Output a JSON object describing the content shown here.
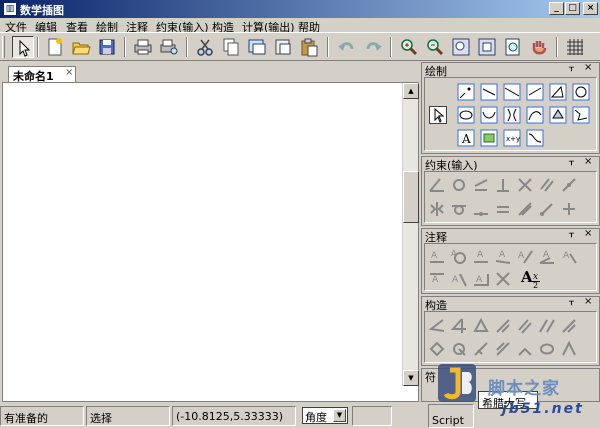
{
  "window": {
    "title": "数学插图",
    "app_icon_glyph": "▥",
    "minimize": "_",
    "maximize": "□",
    "close": "×"
  },
  "menu": [
    "文件",
    "编辑",
    "查看",
    "绘制",
    "注释",
    "约束(输入)",
    "构造",
    "计算(输出)",
    "帮助"
  ],
  "toolbar_icons": [
    "select-arrow-icon",
    "new-doc-icon",
    "open-folder-icon",
    "save-icon",
    "print-icon",
    "print-preview-icon",
    "cut-icon",
    "copy-icon",
    "copy-image-icon",
    "paste-special-icon",
    "paste-icon",
    "undo-icon",
    "redo-icon",
    "zoom-in-icon",
    "zoom-out-icon",
    "zoom-fit-icon",
    "zoom-window-icon",
    "zoom-page-icon",
    "pan-hand-icon",
    "grid-icon"
  ],
  "document": {
    "tab_label": "未命名1",
    "tab_close": "×",
    "scroll_up": "▲",
    "scroll_down": "▼"
  },
  "panels": {
    "draw": {
      "title": "绘制",
      "pin": "ᚁ",
      "close": "×"
    },
    "constraint": {
      "title": "约束(输入)",
      "pin": "ᚁ",
      "close": "×"
    },
    "annotate": {
      "title": "注释",
      "pin": "ᚁ",
      "close": "×",
      "text_tool": "A",
      "subscript": "x",
      "denominator": "2"
    },
    "construct": {
      "title": "构造",
      "pin": "ᚁ",
      "close": "×"
    },
    "partial": {
      "title": "符"
    }
  },
  "status": {
    "state": "有准备的",
    "mode": "选择",
    "coords": "(-10.8125,5.33333)",
    "unit_value": "角度",
    "dropdown_arrow": "▼",
    "script_label": "Script",
    "font_label": "希腊大写"
  },
  "watermark": {
    "brand": "脚本之家",
    "url": "jb51.net",
    "logo": "JB"
  },
  "colors": {
    "title_start": "#0a246a",
    "title_end": "#a6caf0",
    "face": "#d4d0c8",
    "icon_blue": "#3a6fd8"
  }
}
